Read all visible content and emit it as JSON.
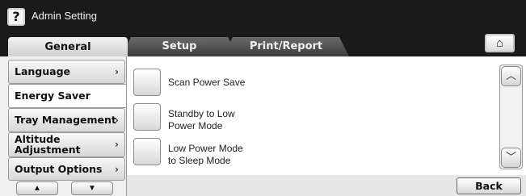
{
  "window": {
    "help_icon": "?",
    "title": "Admin Setting"
  },
  "tabs": [
    {
      "label": "General",
      "selected": true
    },
    {
      "label": "Setup",
      "selected": false
    },
    {
      "label": "Print/Report",
      "selected": false
    }
  ],
  "home_icon": "⌂",
  "sidebar": {
    "items": [
      {
        "label": "Language",
        "chevron": "›",
        "selected": false
      },
      {
        "label": "Energy Saver",
        "chevron": "",
        "selected": true
      },
      {
        "label": "Tray Management",
        "chevron": "›",
        "selected": false
      },
      {
        "label_line1": "Altitude",
        "label_line2": "Adjustment",
        "chevron": "›",
        "selected": false
      },
      {
        "label": "Output Options",
        "chevron": "›",
        "selected": false
      }
    ],
    "scroll_up_icon": "▲",
    "scroll_down_icon": "▼"
  },
  "options": [
    {
      "label": "Scan Power Save"
    },
    {
      "label_line1": "Standby to Low",
      "label_line2": "Power Mode"
    },
    {
      "label_line1": "Low Power Mode",
      "label_line2": "to Sleep Mode"
    }
  ],
  "scrollbar": {
    "up_icon": "︿",
    "down_icon": "﹀"
  },
  "back_label": "Back"
}
